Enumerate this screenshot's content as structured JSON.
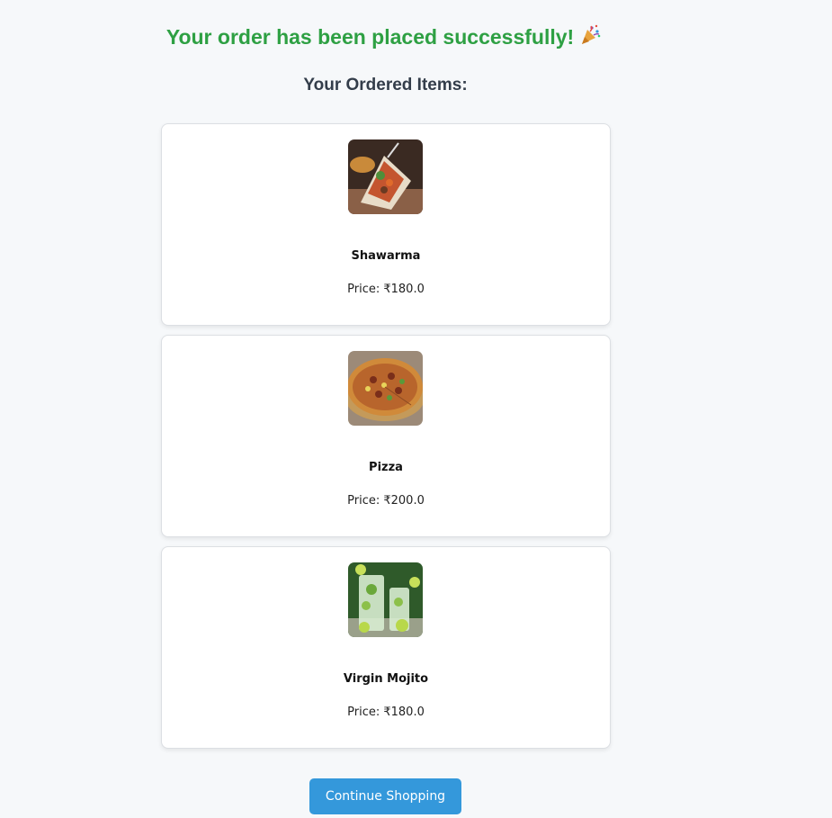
{
  "header": {
    "success_message": "Your order has been placed successfully!",
    "celebration_icon": "party-popper-icon",
    "ordered_items_heading": "Your Ordered Items:"
  },
  "items": [
    {
      "name": "Shawarma",
      "price_text": "Price: ₹180.0",
      "image_icon": "shawarma-wrap-image"
    },
    {
      "name": "Pizza",
      "price_text": "Price: ₹200.0",
      "image_icon": "pizza-image"
    },
    {
      "name": "Virgin Mojito",
      "price_text": "Price: ₹180.0",
      "image_icon": "mojito-drink-image"
    }
  ],
  "actions": {
    "continue_label": "Continue Shopping"
  },
  "colors": {
    "success_green": "#2ea043",
    "heading_dark": "#333d4a",
    "button_blue": "#3498db",
    "page_background": "#f6f8fa"
  }
}
